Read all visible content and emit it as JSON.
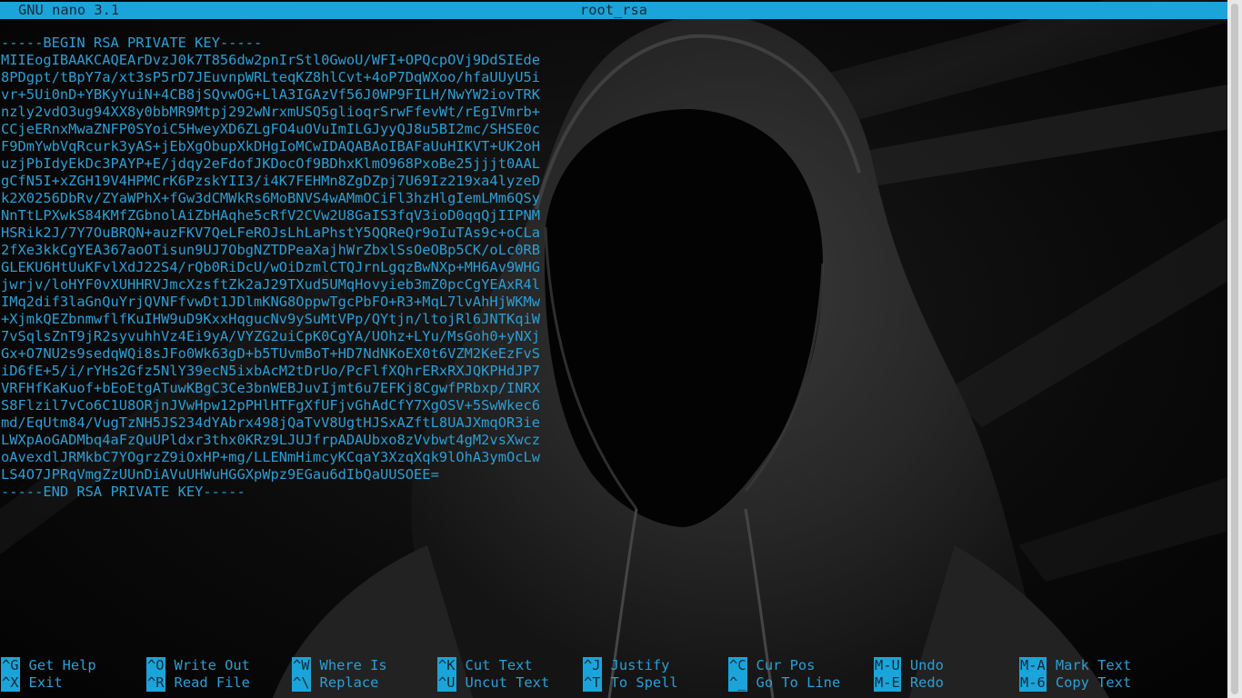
{
  "app": {
    "name": "GNU nano 3.1",
    "file_name": "root_rsa"
  },
  "editor": {
    "lines": [
      "-----BEGIN RSA PRIVATE KEY-----",
      "MIIEogIBAAKCAQEArDvzJ0k7T856dw2pnIrStl0GwoU/WFI+OPQcpOVj9DdSIEde",
      "8PDgpt/tBpY7a/xt3sP5rD7JEuvnpWRLteqKZ8hlCvt+4oP7DqWXoo/hfaUUyU5i",
      "vr+5Ui0nD+YBKyYuiN+4CB8jSQvwOG+LlA3IGAzVf56J0WP9FILH/NwYW2iovTRK",
      "nzly2vdO3ug94XX8y0bbMR9Mtpj292wNrxmUSQ5glioqrSrwFfevWt/rEgIVmrb+",
      "CCjeERnxMwaZNFP0SYoiC5HweyXD6ZLgFO4uOVuImILGJyyQJ8u5BI2mc/SHSE0c",
      "F9DmYwbVqRcurk3yAS+jEbXgObupXkDHgIoMCwIDAQABAoIBAFaUuHIKVT+UK2oH",
      "uzjPbIdyEkDc3PAYP+E/jdqy2eFdofJKDocOf9BDhxKlmO968PxoBe25jjjt0AAL",
      "gCfN5I+xZGH19V4HPMCrK6PzskYII3/i4K7FEHMn8ZgDZpj7U69Iz219xa4lyzeD",
      "k2X0256DbRv/ZYaWPhX+fGw3dCMWkRs6MoBNVS4wAMmOCiFl3hzHlgIemLMm6QSy",
      "NnTtLPXwkS84KMfZGbnolAiZbHAqhe5cRfV2CVw2U8GaIS3fqV3ioD0qqQjIIPNM",
      "HSRik2J/7Y7OuBRQN+auzFKV7QeLFeROJsLhLaPhstY5QQReQr9oIuTAs9c+oCLa",
      "2fXe3kkCgYEA367aoOTisun9UJ7ObgNZTDPeaXajhWrZbxlSsOeOBp5CK/oLc0RB",
      "GLEKU6HtUuKFvlXdJ22S4/rQb0RiDcU/wOiDzmlCTQJrnLgqzBwNXp+MH6Av9WHG",
      "jwrjv/loHYF0vXUHHRVJmcXzsftZk2aJ29TXud5UMqHovyieb3mZ0pcCgYEAxR4l",
      "IMq2dif3laGnQuYrjQVNFfvwDt1JDlmKNG8OppwTgcPbFO+R3+MqL7lvAhHjWKMw",
      "+XjmkQEZbnmwflfKuIHW9uD9KxxHqgucNv9ySuMtVPp/QYtjn/ltojRl6JNTKqiW",
      "7vSqlsZnT9jR2syvuhhVz4Ei9yA/VYZG2uiCpK0CgYA/UOhz+LYu/MsGoh0+yNXj",
      "Gx+O7NU2s9sedqWQi8sJFo0Wk63gD+b5TUvmBoT+HD7NdNKoEX0t6VZM2KeEzFvS",
      "iD6fE+5/i/rYHs2Gfz5NlY39ecN5ixbAcM2tDrUo/PcFlfXQhrERxRXJQKPHdJP7",
      "VRFHfKaKuof+bEoEtgATuwKBgC3Ce3bnWEBJuvIjmt6u7EFKj8CgwfPRbxp/INRX",
      "S8Flzil7vCo6C1U8ORjnJVwHpw12pPHlHTFgXfUFjvGhAdCfY7XgOSV+5SwWkec6",
      "md/EqUtm84/VugTzNH5JS234dYAbrx498jQaTvV8UgtHJSxAZftL8UAJXmqOR3ie",
      "LWXpAoGADMbq4aFzQuUPldxr3thx0KRz9LJUJfrpADAUbxo8zVvbwt4gM2vsXwcz",
      "oAvexdlJRMkbC7YOgrzZ9iOxHP+mg/LLENmHimcyKCqaY3XzqXqk9lOhA3ymOcLw",
      "LS4O7JPRqVmgZzUUnDiAVuUHWuHGGXpWpz9EGau6dIbQaUUSOEE=",
      "-----END RSA PRIVATE KEY-----"
    ]
  },
  "shortcuts": [
    {
      "key": "^G",
      "label": "Get Help"
    },
    {
      "key": "^O",
      "label": "Write Out"
    },
    {
      "key": "^W",
      "label": "Where Is"
    },
    {
      "key": "^K",
      "label": "Cut Text"
    },
    {
      "key": "^J",
      "label": "Justify"
    },
    {
      "key": "^C",
      "label": "Cur Pos"
    },
    {
      "key": "M-U",
      "label": "Undo"
    },
    {
      "key": "M-A",
      "label": "Mark Text"
    },
    {
      "key": "^X",
      "label": "Exit"
    },
    {
      "key": "^R",
      "label": "Read File"
    },
    {
      "key": "^\\",
      "label": "Replace"
    },
    {
      "key": "^U",
      "label": "Uncut Text"
    },
    {
      "key": "^T",
      "label": "To Spell"
    },
    {
      "key": "^_",
      "label": "Go To Line"
    },
    {
      "key": "M-E",
      "label": "Redo"
    },
    {
      "key": "M-6",
      "label": "Copy Text"
    }
  ],
  "colors": {
    "accent": "#1ba4d9",
    "text": "#2a9fd6",
    "background": "#050505"
  },
  "icons": {
    "wallpaper": "hooded-figure-wallpaper"
  }
}
